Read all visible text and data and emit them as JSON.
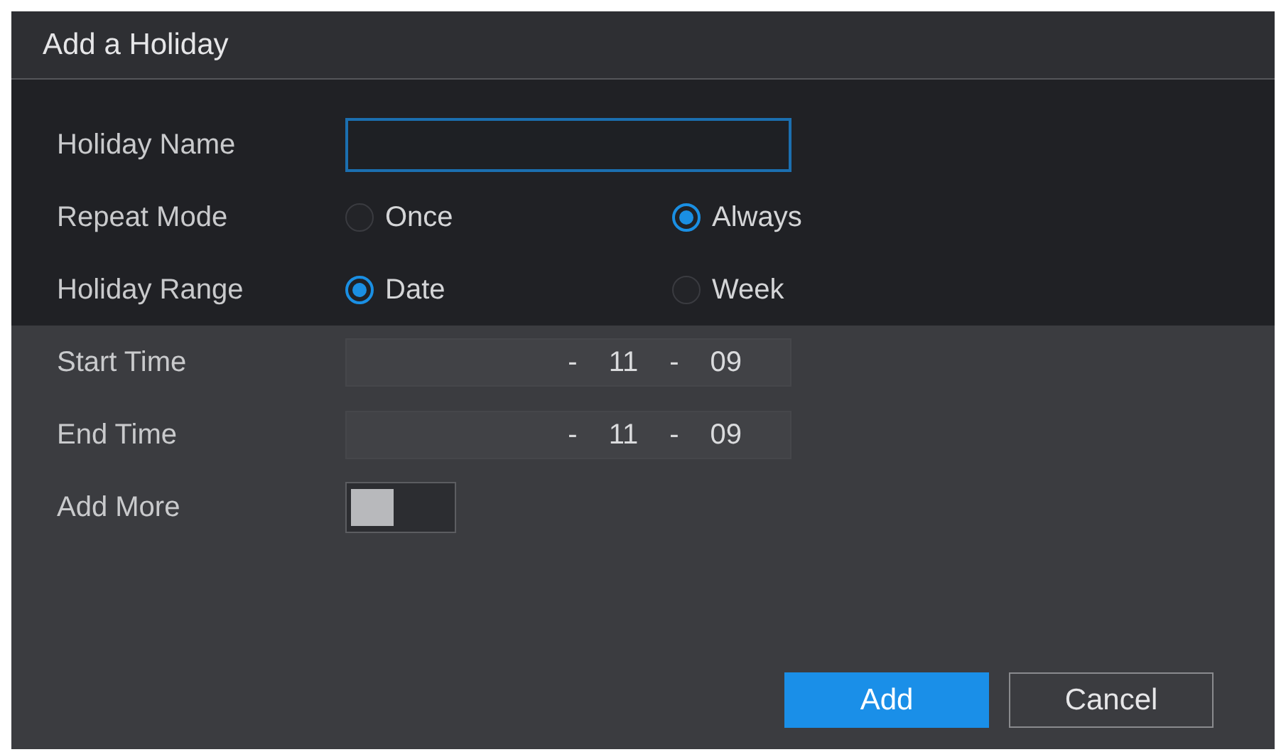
{
  "dialog": {
    "title": "Add a Holiday"
  },
  "holiday_name": {
    "label": "Holiday Name"
  },
  "repeat_mode": {
    "label": "Repeat Mode",
    "options": [
      {
        "label": "Once",
        "selected": false
      },
      {
        "label": "Always",
        "selected": true
      }
    ]
  },
  "holiday_range": {
    "label": "Holiday Range",
    "options": [
      {
        "label": "Date",
        "selected": true
      },
      {
        "label": "Week",
        "selected": false
      }
    ]
  },
  "start_time": {
    "label": "Start Time",
    "parts": [
      "-",
      "11",
      "-",
      "09"
    ]
  },
  "end_time": {
    "label": "End Time",
    "parts": [
      "-",
      "11",
      "-",
      "09"
    ]
  },
  "add_more": {
    "label": "Add More",
    "on": false
  },
  "buttons": [
    {
      "label": "Add",
      "kind": "primary"
    },
    {
      "label": "Cancel",
      "kind": "secondary"
    }
  ]
}
